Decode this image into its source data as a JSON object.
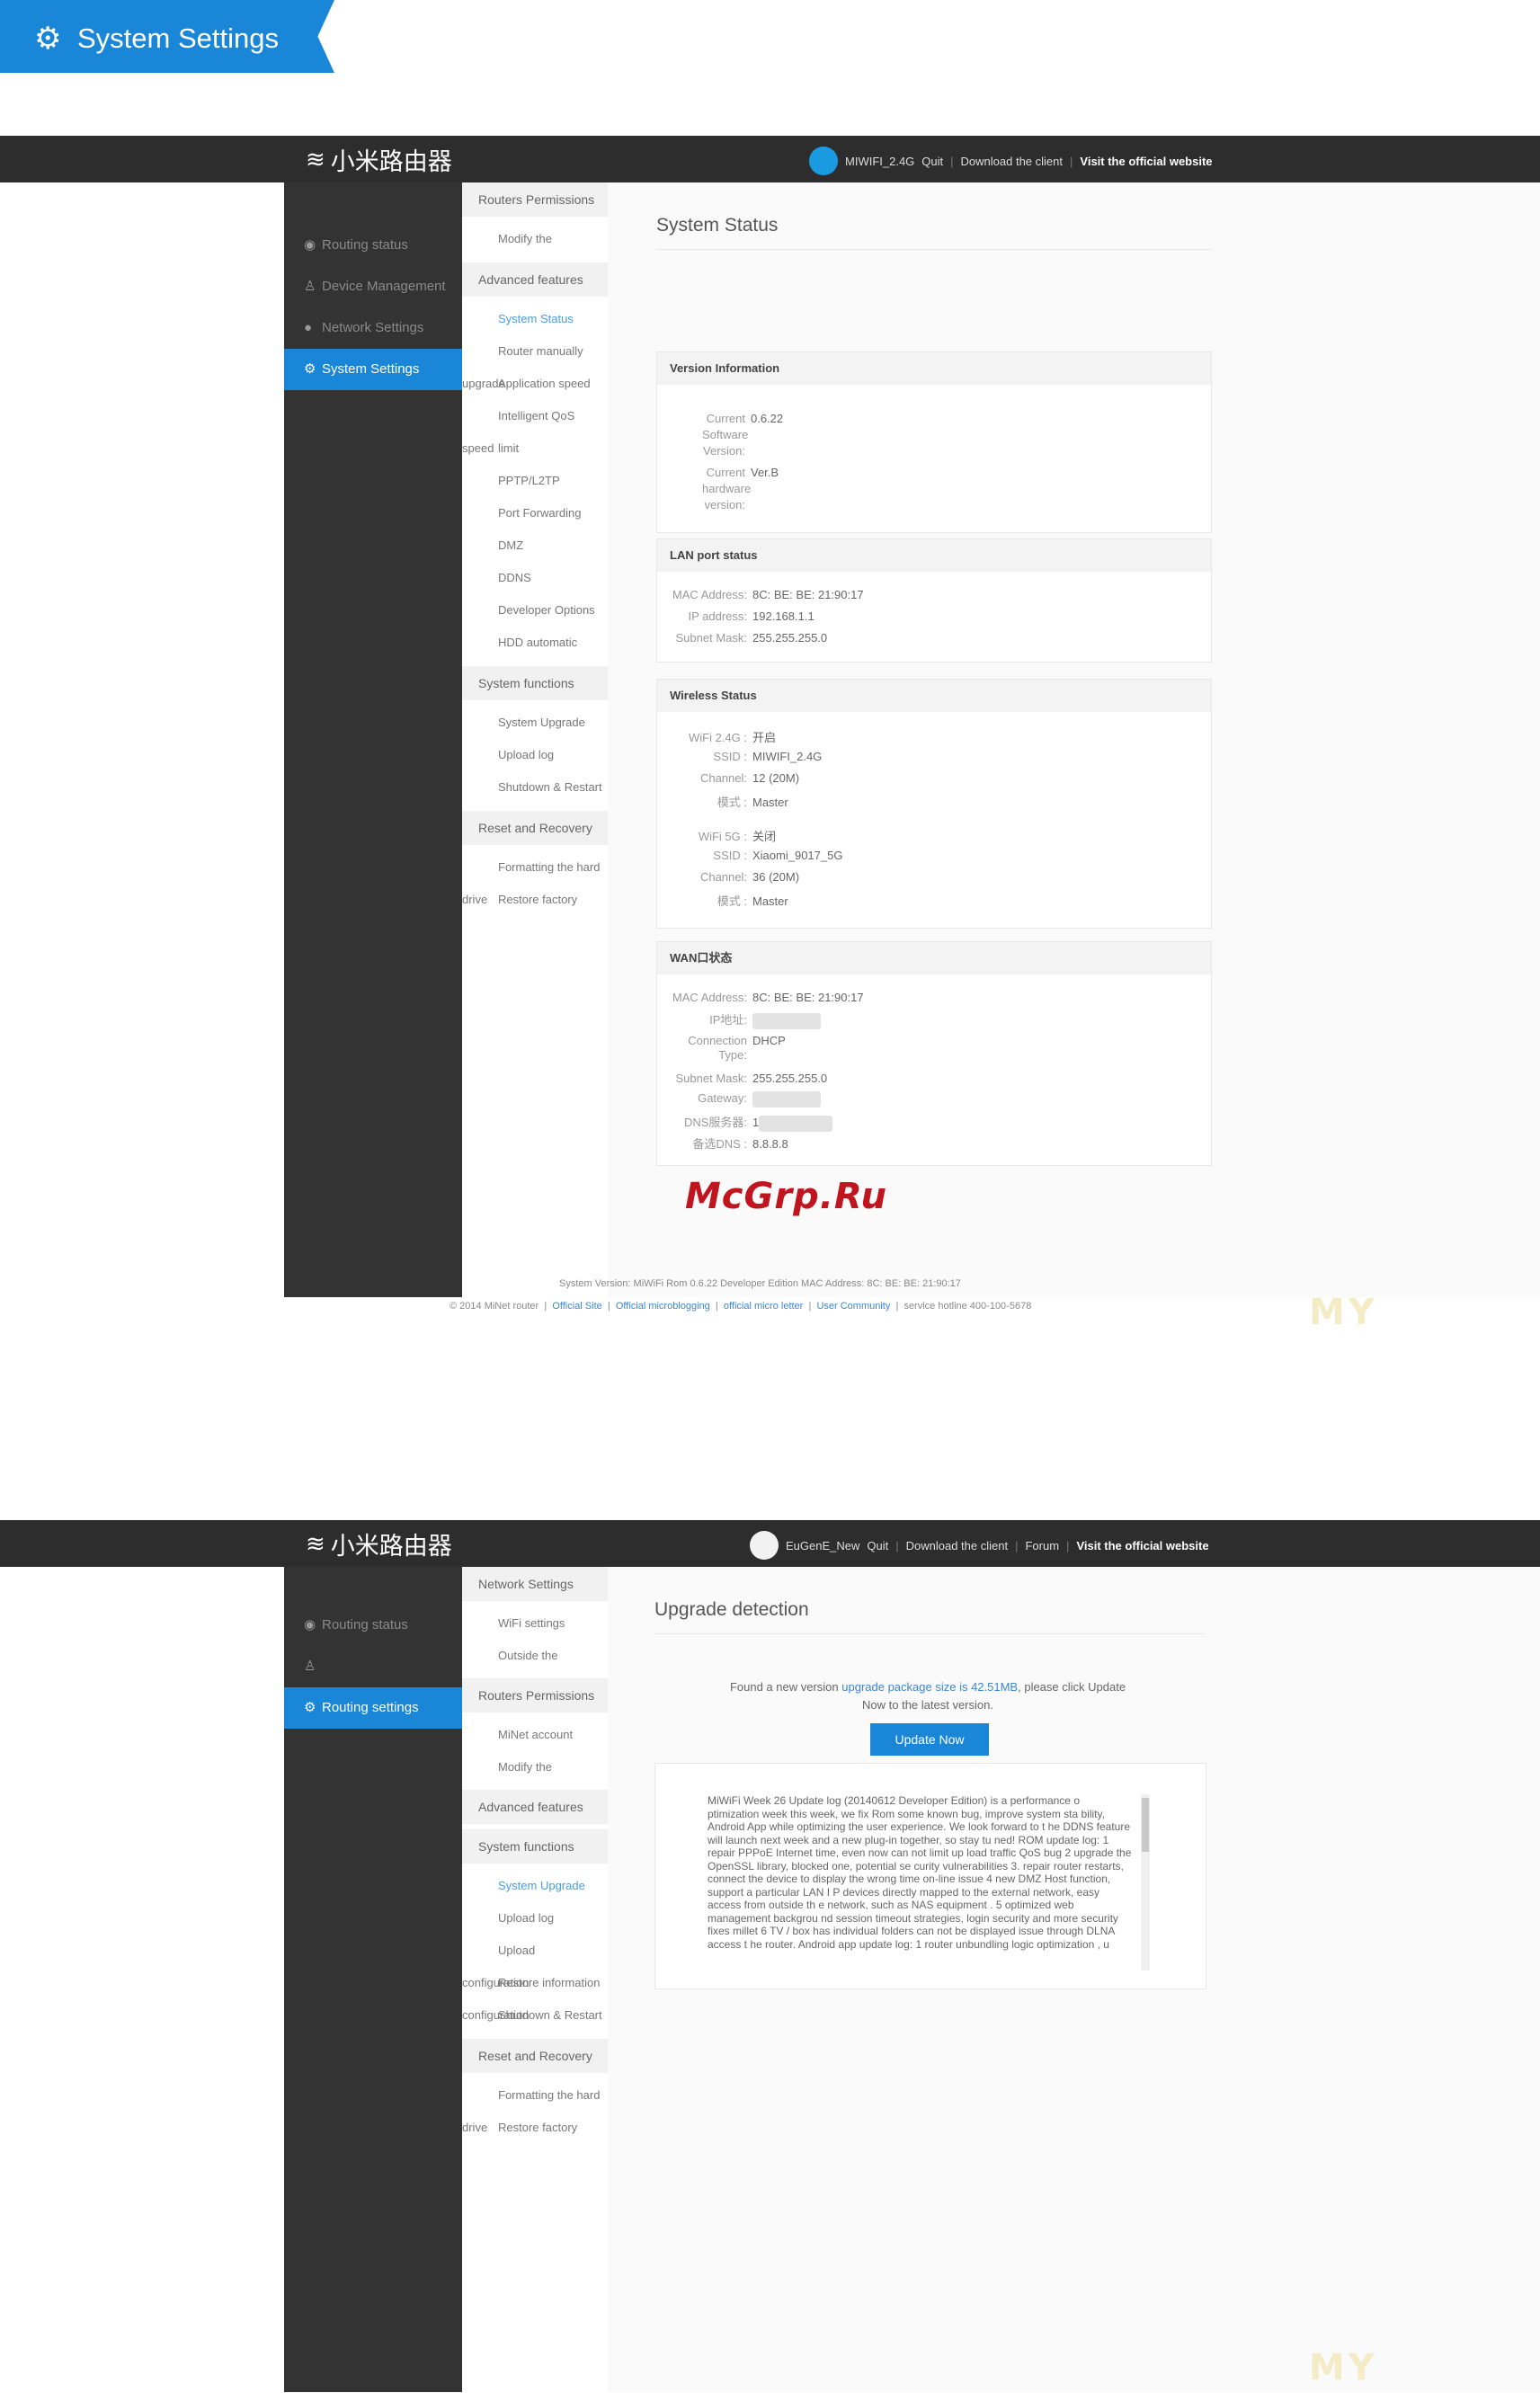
{
  "header_banner": {
    "title": "System Settings",
    "icon": "gear-icon"
  },
  "screen1": {
    "brand": "小米路由器",
    "topbar": {
      "user": "MIWIFI_2.4G",
      "quit": "Quit",
      "download": "Download the client",
      "official": "Visit the official website"
    },
    "sidebar": [
      {
        "label": "Routing status",
        "icon": "dashboard-icon"
      },
      {
        "label": "Device Management",
        "icon": "user-icon"
      },
      {
        "label": "Network Settings",
        "icon": "globe-icon"
      },
      {
        "label": "System Settings",
        "icon": "gear-icon",
        "active": true
      }
    ],
    "submenu": {
      "routers_permissions": "Routers Permissions",
      "modify": "Modify the",
      "advanced": "Advanced features",
      "system_status": "System Status",
      "router_manually": "Router manually",
      "upgrade_fragment": "upgrade",
      "application_speed": "Application speed",
      "intelligent_qos": "Intelligent QoS",
      "speed_fragment": "speed",
      "limit_fragment": "limit",
      "pptp": "PPTP/L2TP",
      "port_forwarding": "Port Forwarding",
      "dmz": "DMZ",
      "ddns": "DDNS",
      "developer_options": "Developer Options",
      "hdd_automatic": "HDD automatic",
      "system_functions": "System functions",
      "system_upgrade": "System Upgrade",
      "upload_log": "Upload log",
      "shutdown_restart": "Shutdown & Restart",
      "reset_recovery": "Reset and Recovery",
      "formatting": "Formatting the hard",
      "drive_fragment": "drive",
      "restore_factory": "Restore factory"
    },
    "page_title": "System Status",
    "version": {
      "title": "Version Information",
      "software_label_1": "Current",
      "software_label_2": "Software",
      "software_label_3": "Version:",
      "software_value": "0.6.22",
      "hardware_label_1": "Current",
      "hardware_label_2": "hardware",
      "hardware_label_3": "version:",
      "hardware_value": "Ver.B"
    },
    "lan": {
      "title": "LAN port status",
      "mac_label": "MAC Address:",
      "mac_value": "8C: BE: BE: 21:90:17",
      "ip_label": "IP address:",
      "ip_value": "192.168.1.1",
      "mask_label": "Subnet Mask:",
      "mask_value": "255.255.255.0"
    },
    "wireless": {
      "title": "Wireless Status",
      "w24_label": "WiFi 2.4G :",
      "w24_value": "开启",
      "ssid1_label": "SSID :",
      "ssid1_value": "MIWIFI_2.4G",
      "ch1_label": "Channel:",
      "ch1_value": "12 (20M)",
      "mode1_label": "模式 :",
      "mode1_value": "Master",
      "w5_label": "WiFi 5G :",
      "w5_value": "关闭",
      "ssid2_label": "SSID :",
      "ssid2_value": "Xiaomi_9017_5G",
      "ch2_label": "Channel:",
      "ch2_value": "36 (20M)",
      "mode2_label": "模式 :",
      "mode2_value": "Master"
    },
    "wan": {
      "title": "WAN口状态",
      "mac_label": "MAC Address:",
      "mac_value": "8C: BE: BE: 21:90:17",
      "ip_label": "IP地址:",
      "conn_label_1": "Connection",
      "conn_label_2": "Type:",
      "conn_value": "DHCP",
      "mask_label": "Subnet Mask:",
      "mask_value": "255.255.255.0",
      "gw_label": "Gateway:",
      "dns_label": "DNS服务器:",
      "dns_value": "1",
      "dns2_label": "备选DNS :",
      "dns2_value": "8.8.8.8"
    },
    "watermark": "McGrp.Ru",
    "footer": {
      "line1": "System Version: MiWiFi Rom 0.6.22 Developer Edition MAC Address: 8C: BE: BE: 21:90:17",
      "copyright": "© 2014 MiNet router",
      "links": [
        "Official Site",
        "Official microblogging",
        "official micro letter",
        "User Community"
      ],
      "hotline": "service hotline 400-100-5678"
    },
    "faint_mark": "MY"
  },
  "screen2": {
    "brand": "小米路由器",
    "topbar": {
      "user": "EuGenE_New",
      "quit": "Quit",
      "download": "Download the client",
      "forum": "Forum",
      "official": "Visit the official website"
    },
    "sidebar": [
      {
        "label": "Routing status",
        "icon": "dashboard-icon"
      },
      {
        "label": "",
        "icon": "user-icon"
      },
      {
        "label": "Routing settings",
        "icon": "gear-icon",
        "active": true
      }
    ],
    "submenu": {
      "network_settings": "Network Settings",
      "wifi_settings": "WiFi settings",
      "outside": "Outside the",
      "routers_permissions": "Routers Permissions",
      "minet_account": "MiNet account",
      "modify": "Modify the",
      "advanced": "Advanced features",
      "system_functions": "System functions",
      "system_upgrade": "System Upgrade",
      "upload_log": "Upload log",
      "upload": "Upload",
      "config_fragment_1": "configuration",
      "restore_information": "Restore information",
      "config_fragment_2": "configuration",
      "shutdown_restart": "Shutdown & Restart",
      "reset_recovery": "Reset and Recovery",
      "formatting": "Formatting the hard",
      "drive_fragment": "drive",
      "restore_factory": "Restore factory"
    },
    "page_title": "Upgrade detection",
    "found_prefix": "Found a new version",
    "found_link": "upgrade package size is 42.51MB",
    "found_suffix": ", please click Update",
    "found_line2": "Now to the latest version.",
    "update_button": "Update Now",
    "log": "MiWiFi Week 26 Update log (20140612 Developer Edition) is a performance o ptimization week this week, we fix Rom some known bug, improve system sta bility, Android App while optimizing the user experience. We look forward to t he DDNS feature will launch next week and a new plug-in together, so stay tu ned! ROM update log: 1 repair PPPoE Internet time, even now can not limit up load traffic QoS bug 2 upgrade the OpenSSL library, blocked one, potential se curity vulnerabilities 3. repair router restarts, connect the device to display the wrong time on-line issue 4 new DMZ Host function, support a particular LAN I P devices directly mapped to the external network, easy access from outside th e network, such as NAS equipment . 5 optimized web management backgrou nd session timeout strategies, login security and more security fixes millet 6 TV / box has individual folders can not be displayed issue through DLNA access t he router. Android app update log: 1 router unbundling logic optimization , u",
    "faint_mark": "MY"
  }
}
